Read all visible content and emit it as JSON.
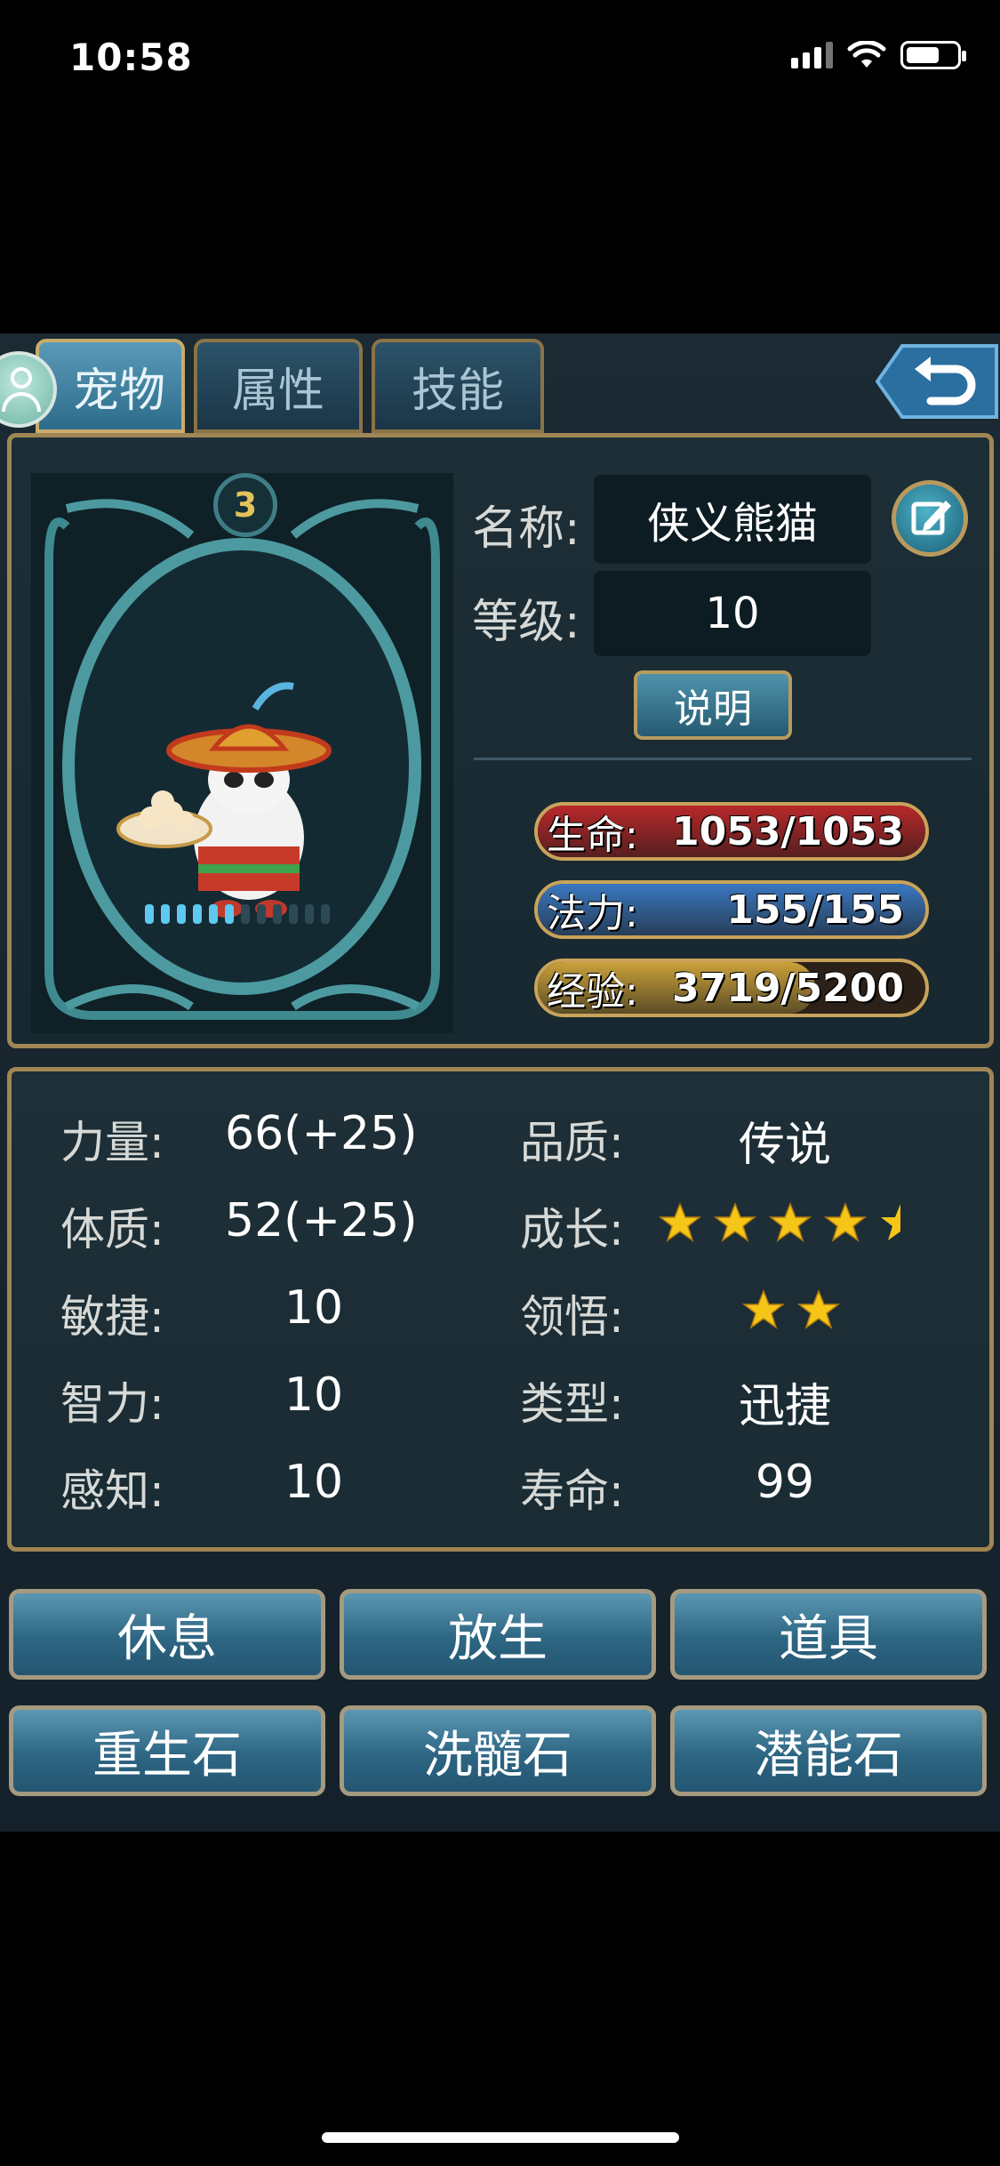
{
  "status_bar": {
    "time": "10:58"
  },
  "tabs": [
    {
      "label": "宠物",
      "active": true
    },
    {
      "label": "属性",
      "active": false
    },
    {
      "label": "技能",
      "active": false
    }
  ],
  "pet": {
    "rank_badge": "3",
    "name_label": "名称:",
    "name": "侠义熊猫",
    "level_label": "等级:",
    "level": "10",
    "desc_button": "说明",
    "hp": {
      "label": "生命:",
      "value": "1053/1053",
      "fraction": 1.0,
      "color": "#b8282a"
    },
    "mp": {
      "label": "法力:",
      "value": "155/155",
      "fraction": 1.0,
      "color": "#3a78c0"
    },
    "exp": {
      "label": "经验:",
      "value": "3719/5200",
      "fraction": 0.715,
      "color": "#caa13a"
    }
  },
  "stats": {
    "left": [
      {
        "label": "力量:",
        "value": "66(+25)"
      },
      {
        "label": "体质:",
        "value": "52(+25)"
      },
      {
        "label": "敏捷:",
        "value": "10"
      },
      {
        "label": "智力:",
        "value": "10"
      },
      {
        "label": "感知:",
        "value": "10"
      }
    ],
    "quality_label": "品质:",
    "quality": "传说",
    "growth_label": "成长:",
    "growth_stars": 4.5,
    "comprehension_label": "领悟:",
    "comprehension_stars": 2,
    "type_label": "类型:",
    "type": "迅捷",
    "lifespan_label": "寿命:",
    "lifespan": "99"
  },
  "actions": [
    "休息",
    "放生",
    "道具",
    "重生石",
    "洗髓石",
    "潜能石"
  ],
  "colors": {
    "frame_gold": "#a08654",
    "button_blue": "#2d6683",
    "star": "#f5c518"
  }
}
